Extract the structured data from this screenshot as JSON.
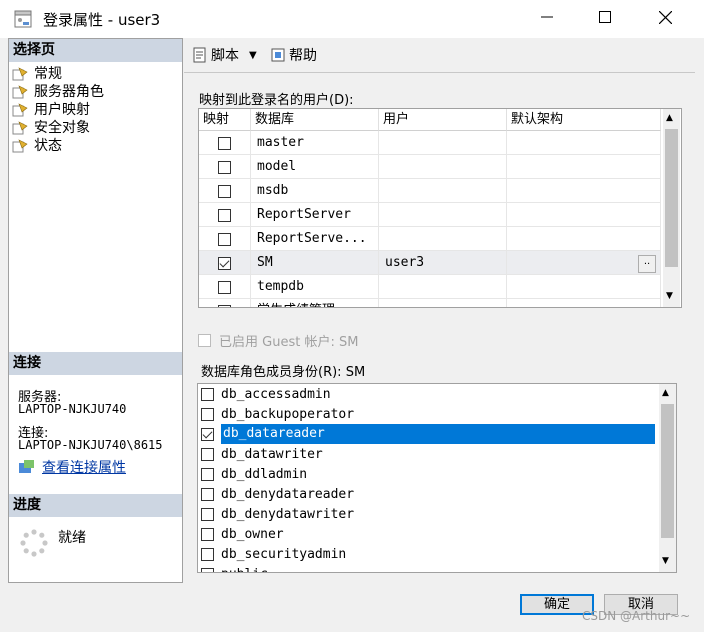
{
  "window": {
    "title": "登录属性 - user3",
    "minimize_icon": "minimize-icon",
    "maximize_icon": "maximize-icon",
    "close_icon": "close-icon"
  },
  "left_pane": {
    "select_page_header": "选择页",
    "pages": [
      {
        "label": "常规",
        "icon": "page-wrench-icon"
      },
      {
        "label": "服务器角色",
        "icon": "page-wrench-icon"
      },
      {
        "label": "用户映射",
        "icon": "page-wrench-icon"
      },
      {
        "label": "安全对象",
        "icon": "page-wrench-icon"
      },
      {
        "label": "状态",
        "icon": "page-wrench-icon"
      }
    ],
    "connection_header": "连接",
    "server_label": "服务器:",
    "server_value": "LAPTOP-NJKJU740",
    "connection_label": "连接:",
    "connection_value": "LAPTOP-NJKJU740\\8615",
    "view_connection_link": "查看连接属性",
    "progress_header": "进度",
    "progress_status": "就绪"
  },
  "toolbar": {
    "script_label": "脚本",
    "help_label": "帮助"
  },
  "mapping": {
    "label": "映射到此登录名的用户(D):",
    "columns": [
      "映射",
      "数据库",
      "用户",
      "默认架构"
    ],
    "rows": [
      {
        "mapped": false,
        "database": "master",
        "user": "",
        "schema": ""
      },
      {
        "mapped": false,
        "database": "model",
        "user": "",
        "schema": ""
      },
      {
        "mapped": false,
        "database": "msdb",
        "user": "",
        "schema": ""
      },
      {
        "mapped": false,
        "database": "ReportServer",
        "user": "",
        "schema": ""
      },
      {
        "mapped": false,
        "database": "ReportServe...",
        "user": "",
        "schema": ""
      },
      {
        "mapped": true,
        "database": "SM",
        "user": "user3",
        "schema": "",
        "selected": true
      },
      {
        "mapped": false,
        "database": "tempdb",
        "user": "",
        "schema": ""
      },
      {
        "mapped": false,
        "database": "学生成绩管理",
        "user": "",
        "schema": ""
      }
    ],
    "ellipsis": ".."
  },
  "guest": {
    "label": "已启用 Guest 帐户: SM",
    "checked": false
  },
  "roles": {
    "label": "数据库角色成员身份(R): SM",
    "items": [
      {
        "name": "db_accessadmin",
        "checked": false
      },
      {
        "name": "db_backupoperator",
        "checked": false
      },
      {
        "name": "db_datareader",
        "checked": true,
        "selected": true
      },
      {
        "name": "db_datawriter",
        "checked": false
      },
      {
        "name": "db_ddladmin",
        "checked": false
      },
      {
        "name": "db_denydatareader",
        "checked": false
      },
      {
        "name": "db_denydatawriter",
        "checked": false
      },
      {
        "name": "db_owner",
        "checked": false
      },
      {
        "name": "db_securityadmin",
        "checked": false
      },
      {
        "name": "public",
        "checked": false
      }
    ]
  },
  "buttons": {
    "ok": "确定",
    "cancel": "取消"
  },
  "watermark": "CSDN @Arthur~~"
}
